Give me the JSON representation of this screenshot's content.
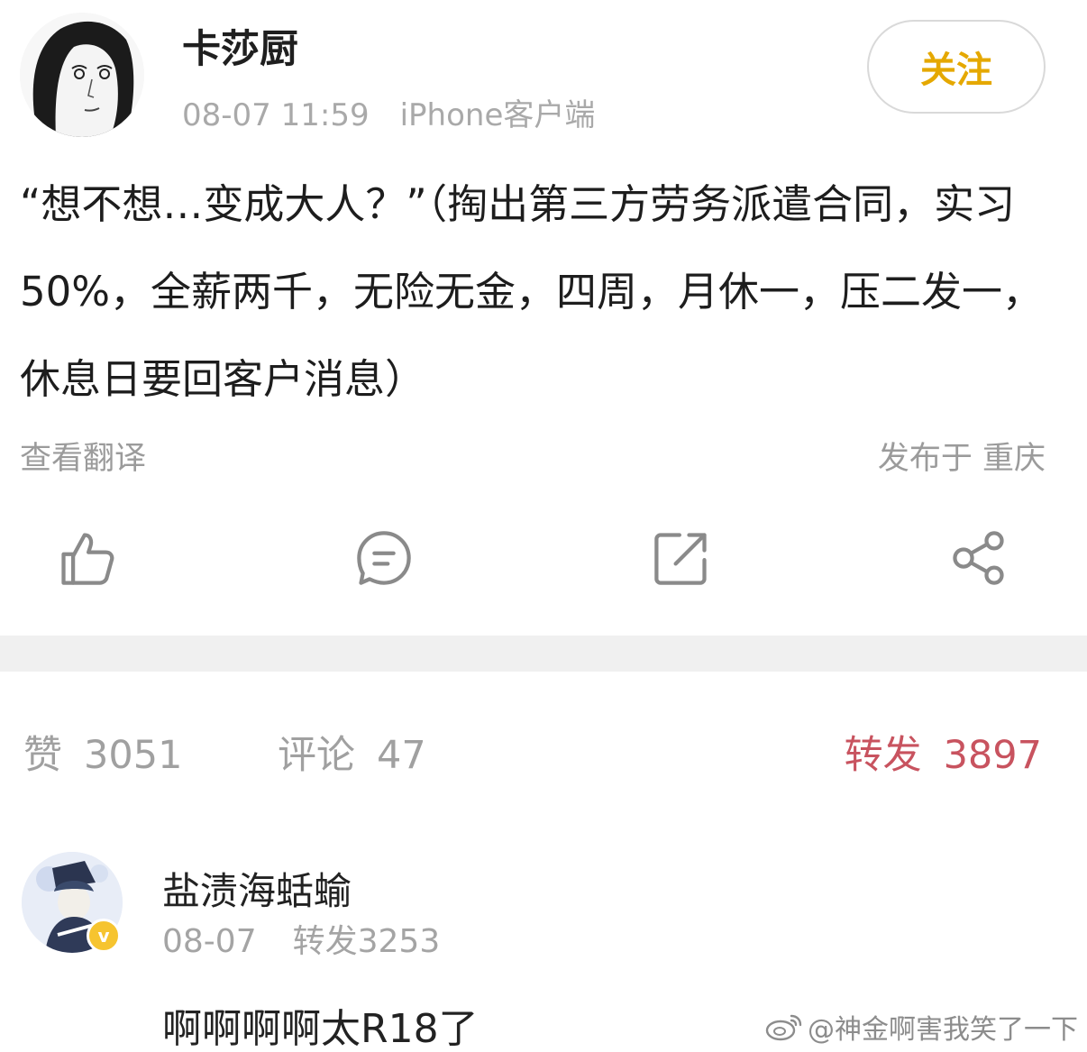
{
  "post": {
    "username": "卡莎厨",
    "time": "08-07 11:59",
    "client": "iPhone客户端",
    "follow_label": "关注",
    "content": "“想不想…变成大人？”（掏出第三方劳务派遣合同，实习50%，全薪两千，无险无金，四周，月休一，压二发一，休息日要回客户消息）",
    "translate_label": "查看翻译",
    "location_label": "发布于 重庆",
    "actions": [
      {
        "icon": "thumbs-up-icon"
      },
      {
        "icon": "comment-icon"
      },
      {
        "icon": "repost-icon"
      },
      {
        "icon": "share-icon"
      }
    ]
  },
  "stats": {
    "likes_label": "赞",
    "likes": "3051",
    "comments_label": "评论",
    "comments": "47",
    "reposts_label": "转发",
    "reposts": "3897"
  },
  "comment": {
    "username": "盐渍海蛞蝓",
    "badge": "v",
    "date": "08-07",
    "repost_label": "转发3253",
    "text": "啊啊啊啊太R18了"
  },
  "watermark": {
    "text": "@神金啊害我笑了一下"
  },
  "colors": {
    "follow": "#e5a800",
    "active_stat": "#c8535f",
    "muted": "#a0a0a0",
    "divider": "#f0f0f0"
  }
}
